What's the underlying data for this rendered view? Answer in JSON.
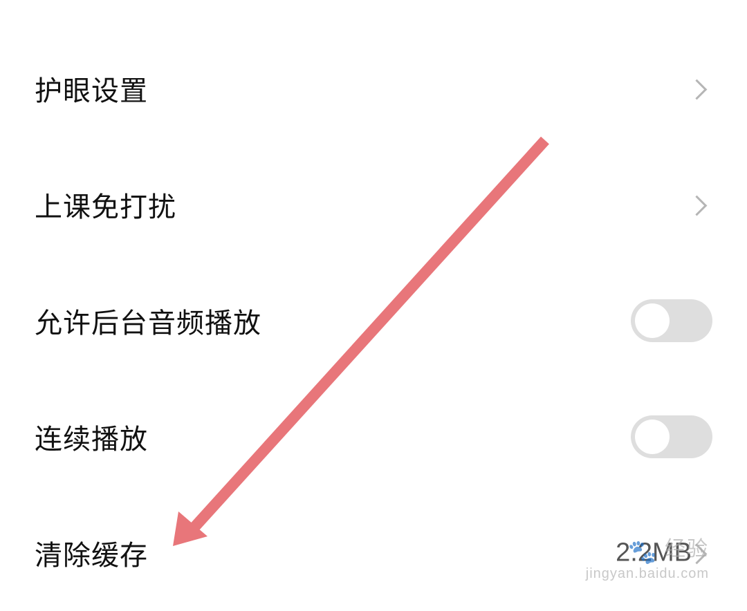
{
  "settings": {
    "items": [
      {
        "label": "护眼设置",
        "control": "chevron"
      },
      {
        "label": "上课免打扰",
        "control": "chevron"
      },
      {
        "label": "允许后台音频播放",
        "control": "toggle",
        "enabled": false
      },
      {
        "label": "连续播放",
        "control": "toggle",
        "enabled": false
      },
      {
        "label": "清除缓存",
        "control": "value",
        "value": "2.2MB"
      }
    ]
  },
  "annotation": {
    "arrow_color": "#e8767a"
  },
  "watermark": {
    "logo_text": "经验",
    "url": "jingyan.baidu.com"
  },
  "colors": {
    "background": "#ffffff",
    "text": "#111111",
    "toggle_off": "#dedede",
    "chevron": "#b5b5b5"
  }
}
